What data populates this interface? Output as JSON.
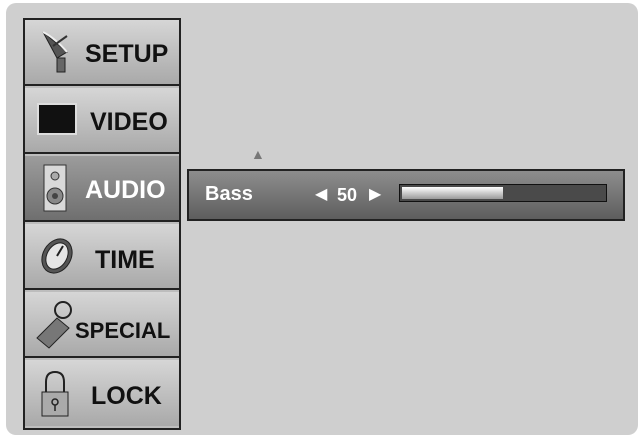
{
  "menu": {
    "items": [
      {
        "label": "SETUP",
        "icon": "satellite-dish-icon",
        "active": false
      },
      {
        "label": "VIDEO",
        "icon": "tv-screen-icon",
        "active": false
      },
      {
        "label": "AUDIO",
        "icon": "speaker-icon",
        "active": true
      },
      {
        "label": "TIME",
        "icon": "clock-icon",
        "active": false
      },
      {
        "label": "SPECIAL",
        "icon": "tag-key-icon",
        "active": false
      },
      {
        "label": "LOCK",
        "icon": "padlock-icon",
        "active": false
      }
    ]
  },
  "audio_panel": {
    "label": "Bass",
    "value": "50",
    "level_percent": 50
  },
  "colors": {
    "screen_bg": "#cfcfcf",
    "menu_bg": "#bdbdbd",
    "active_item": "#8a8a8a",
    "panel_bg": "#767676"
  }
}
